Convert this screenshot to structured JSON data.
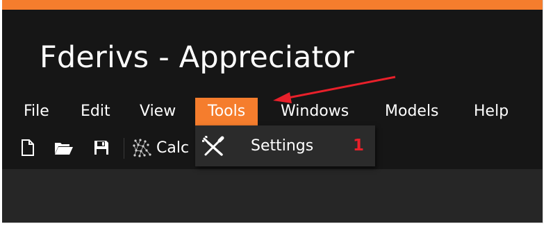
{
  "app": {
    "title": "Fderivs - Appreciator",
    "accent_color": "#f57d2d"
  },
  "menu": {
    "items": [
      {
        "label": "File"
      },
      {
        "label": "Edit"
      },
      {
        "label": "View"
      },
      {
        "label": "Tools",
        "active": true
      },
      {
        "label": "Windows"
      },
      {
        "label": "Models"
      },
      {
        "label": "Help"
      }
    ]
  },
  "toolbar": {
    "buttons": [
      {
        "icon": "new-file-icon"
      },
      {
        "icon": "open-folder-icon"
      },
      {
        "icon": "save-icon"
      }
    ],
    "calc_label": "Calc",
    "calc_icon": "calculate-icon"
  },
  "dropdown": {
    "items": [
      {
        "label": "Settings",
        "icon": "wrench-screwdriver-icon"
      }
    ]
  },
  "annotation": {
    "step": "1",
    "color": "#e8202a"
  }
}
